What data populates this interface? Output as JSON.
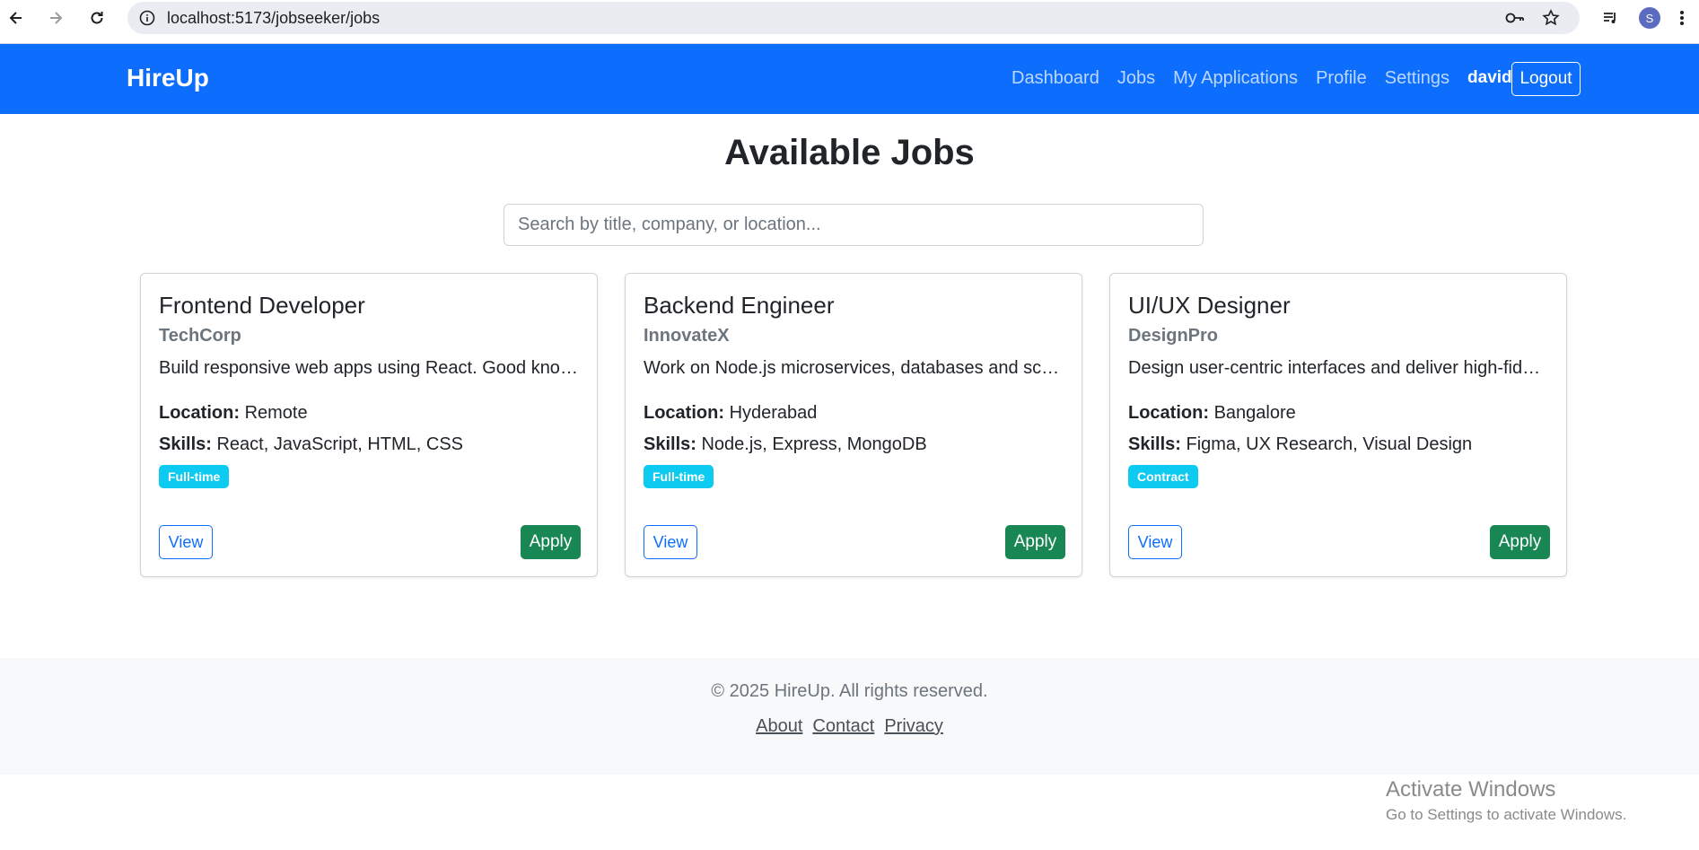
{
  "browser": {
    "url": "localhost:5173/jobseeker/jobs",
    "profile_initial": "S",
    "icons": [
      "back-icon",
      "forward-icon",
      "reload-icon",
      "site-info-icon",
      "password-key-icon",
      "bookmark-star-icon",
      "media-controls-icon",
      "menu-dots-icon"
    ]
  },
  "navbar": {
    "brand": "HireUp",
    "links": [
      "Dashboard",
      "Jobs",
      "My Applications",
      "Profile",
      "Settings"
    ],
    "username": "david",
    "logout_label": "Logout",
    "bg_color": "#0d6efd"
  },
  "main": {
    "title": "Available Jobs",
    "search_placeholder": "Search by title, company, or location...",
    "jobs": [
      {
        "title": "Frontend Developer",
        "company": "TechCorp",
        "description": "Build responsive web apps using React. Good knowledge of JavaScript, HTML and CSS required.",
        "location_label": "Location:",
        "location": "Remote",
        "skills_label": "Skills:",
        "skills": "React, JavaScript, HTML, CSS",
        "type": "Full-time",
        "view_label": "View",
        "apply_label": "Apply"
      },
      {
        "title": "Backend Engineer",
        "company": "InnovateX",
        "description": "Work on Node.js microservices, databases and scalable backend systems.",
        "location_label": "Location:",
        "location": "Hyderabad",
        "skills_label": "Skills:",
        "skills": "Node.js, Express, MongoDB",
        "type": "Full-time",
        "view_label": "View",
        "apply_label": "Apply"
      },
      {
        "title": "UI/UX Designer",
        "company": "DesignPro",
        "description": "Design user-centric interfaces and deliver high-fidelity prototypes.",
        "location_label": "Location:",
        "location": "Bangalore",
        "skills_label": "Skills:",
        "skills": "Figma, UX Research, Visual Design",
        "type": "Contract",
        "view_label": "View",
        "apply_label": "Apply"
      }
    ]
  },
  "footer": {
    "copyright": "© 2025 HireUp. All rights reserved.",
    "links": [
      "About",
      "Contact",
      "Privacy"
    ]
  },
  "watermark": {
    "title": "Activate Windows",
    "subtitle": "Go to Settings to activate Windows."
  },
  "colors": {
    "primary": "#0d6efd",
    "success": "#198754",
    "info": "#0dcaf0",
    "footer_bg": "#f8f9fa"
  }
}
